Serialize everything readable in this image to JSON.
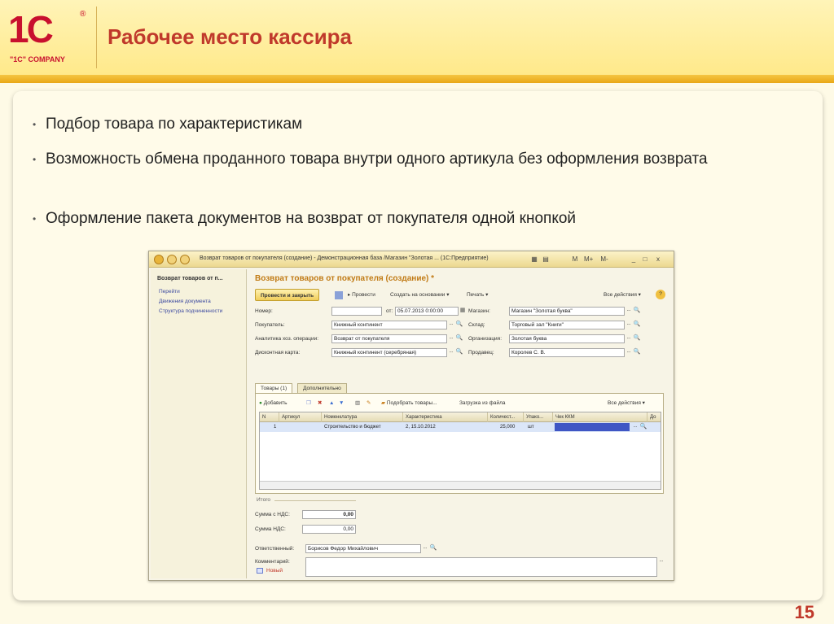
{
  "logo": {
    "mark": "1С",
    "reg": "®",
    "text": "\"1C\" COMPANY"
  },
  "slide_title": "Рабочее место кассира",
  "bullets": [
    "Подбор товара по характеристикам",
    "Возможность обмена проданного товара внутри одного артикула без оформления возврата",
    "Оформление пакета документов на возврат от покупателя одной кнопкой"
  ],
  "page_number": "15",
  "window": {
    "title": "Возврат товаров от покупателя (создание) - Демонстрационная база /Магазин \"Золотая ...   (1С:Предприятие)",
    "title_icons": [
      "M",
      "M+",
      "M-",
      "_",
      "□",
      "x"
    ],
    "nav": {
      "title": "Возврат товаров от п...",
      "items": [
        "Перейти",
        "Движения документа",
        "Структура подчиненности"
      ]
    },
    "doc_title": "Возврат товаров от покупателя (создание) *",
    "commands": {
      "post_close": "Провести и закрыть",
      "post": "Провести",
      "create_based": "Создать на основании ▾",
      "print": "Печать ▾",
      "all_actions": "Все действия ▾"
    },
    "form": {
      "number_label": "Номер:",
      "number_value": "",
      "from_label": "от:",
      "date_value": "05.07.2013  0:00:00",
      "store_label": "Магазин:",
      "store_value": "Магазин \"Золотая буква\"",
      "customer_label": "Покупатель:",
      "customer_value": "Книжный континент",
      "warehouse_label": "Склад:",
      "warehouse_value": "Торговый зал \"Книги\"",
      "analytics_label": "Аналитика хоз. операции:",
      "analytics_value": "Возврат от покупателя",
      "org_label": "Организация:",
      "org_value": "Золотая буква",
      "card_label": "Дисконтная карта:",
      "card_value": "Книжный континент (серебряная)",
      "seller_label": "Продавец:",
      "seller_value": "Королев С. В."
    },
    "tabs": [
      "Товары (1)",
      "Дополнительно"
    ],
    "grid_tools": {
      "add": "Добавить",
      "pick": "Подобрать товары...",
      "load": "Загрузка из файла",
      "all_actions": "Все действия ▾"
    },
    "grid": {
      "columns": [
        "N",
        "Артикул",
        "Номенклатура",
        "Характеристика",
        "Количест...",
        "Упако...",
        "Чек ККМ",
        "До"
      ],
      "rows": [
        [
          "1",
          "",
          "Строительство и бюджет",
          "2, 15.10.2012",
          "25,000",
          "шт",
          "",
          ""
        ]
      ]
    },
    "totals": {
      "title": "Итого",
      "sum_vat_label": "Сумма с НДС:",
      "sum_vat_value": "0,00",
      "vat_label": "Сумма НДС:",
      "vat_value": "0,00"
    },
    "responsible_label": "Ответственный:",
    "responsible_value": "Борисов Федор Михайлович",
    "comment_label": "Комментарий:",
    "comment_value": "",
    "status_note": "Новый"
  }
}
